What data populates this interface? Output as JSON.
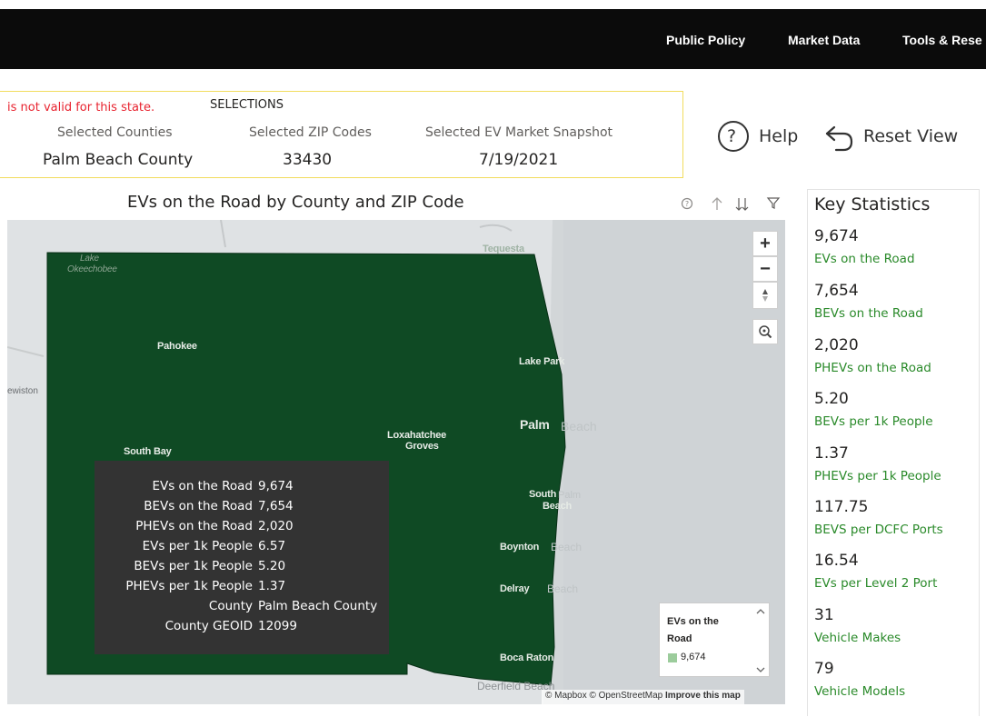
{
  "nav": {
    "items": [
      "Public Policy",
      "Market Data",
      "Tools & Rese"
    ]
  },
  "selections": {
    "warning": "is not valid for this state.",
    "heading": "SELECTIONS",
    "counties_label": "Selected Counties",
    "counties_value": "Palm Beach County",
    "zip_label": "Selected ZIP Codes",
    "zip_value": "33430",
    "snapshot_label": "Selected EV Market Snapshot",
    "snapshot_value": "7/19/2021"
  },
  "actions": {
    "help_label": "Help",
    "help_glyph": "?",
    "reset_label": "Reset View"
  },
  "map": {
    "title": "EVs on the Road by County and ZIP Code",
    "labels": {
      "lake": "Lake",
      "okeechobee": "Okeechobee",
      "pahokee": "Pahokee",
      "lake_park": "Lake Park",
      "palm": "Palm",
      "palm_beach_rest": "Beach",
      "loxahatchee": "Loxahatchee",
      "groves": "Groves",
      "south_bay": "South Bay",
      "lewiston": "ewiston",
      "tequesta": "Tequesta",
      "south": "South",
      "south_palm": "Palm",
      "south_beach": "Beach",
      "boynton": "Boynton",
      "boynton_rest": "Beach",
      "delray": "Delray",
      "delray_rest": "Beach",
      "boca": "Boca Raton",
      "deerfield": "Deerfield Beach"
    },
    "attribution": "© Mapbox © OpenStreetMap",
    "improve": "Improve this map",
    "zoom_in": "+",
    "zoom_out": "−",
    "colors": {
      "county_fill": "#0f4a24",
      "background": "#dfe2e4",
      "tooltip_bg": "#333333",
      "legend_swatch": "#9ccc9c"
    }
  },
  "tooltip": {
    "rows": [
      {
        "label": "EVs on the Road",
        "value": "9,674"
      },
      {
        "label": "BEVs on the Road",
        "value": "7,654"
      },
      {
        "label": "PHEVs on the Road",
        "value": "2,020"
      },
      {
        "label": "EVs per 1k People",
        "value": "6.57"
      },
      {
        "label": "BEVs per 1k People",
        "value": "5.20"
      },
      {
        "label": "PHEVs per 1k People",
        "value": "1.37"
      },
      {
        "label": "County",
        "value": "Palm Beach County"
      },
      {
        "label": "County GEOID",
        "value": "12099"
      }
    ]
  },
  "legend": {
    "title_line1": "EVs on the",
    "title_line2": "Road",
    "item": "9,674"
  },
  "stats": {
    "title": "Key Statistics",
    "items": [
      {
        "value": "9,674",
        "label": "EVs on the Road"
      },
      {
        "value": "7,654",
        "label": "BEVs on the Road"
      },
      {
        "value": "2,020",
        "label": "PHEVs on the Road"
      },
      {
        "value": "5.20",
        "label": "BEVs per 1k People"
      },
      {
        "value": "1.37",
        "label": "PHEVs per 1k People"
      },
      {
        "value": "117.75",
        "label": "BEVS per DCFC Ports"
      },
      {
        "value": "16.54",
        "label": "EVs per Level 2 Port"
      },
      {
        "value": "31",
        "label": "Vehicle Makes"
      },
      {
        "value": "79",
        "label": "Vehicle Models"
      }
    ],
    "colors": {
      "label": "#2a8a2a"
    }
  }
}
